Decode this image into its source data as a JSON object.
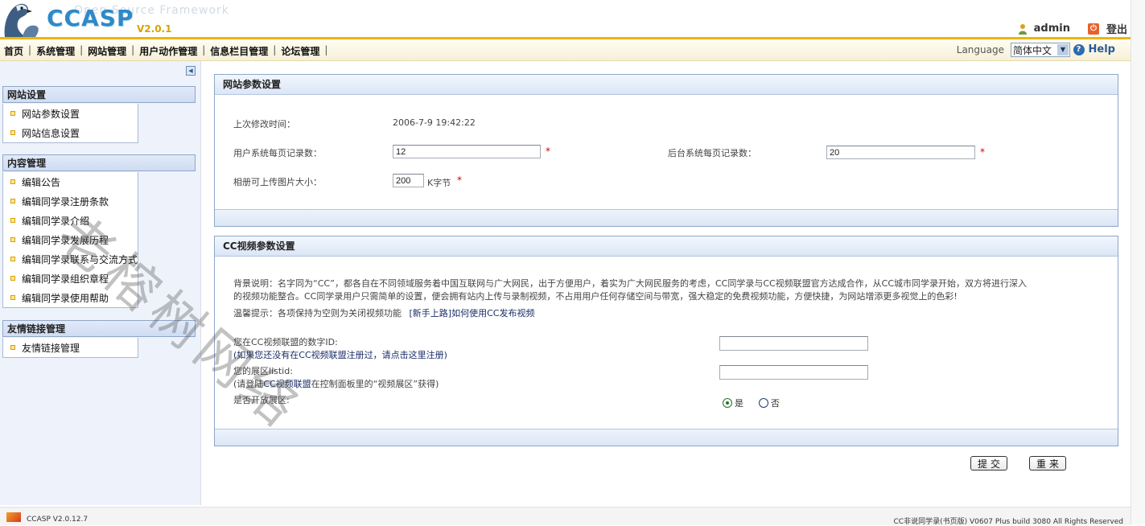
{
  "header": {
    "logo_text": "CCASP",
    "logo_version": "V2.0.1",
    "logo_subtitle": "Open Source Framework",
    "user": "admin",
    "logout": "登出"
  },
  "menu": {
    "items": [
      "首页",
      "系统管理",
      "网站管理",
      "用户动作管理",
      "信息栏目管理",
      "论坛管理"
    ],
    "language_label": "Language",
    "language_value": "简体中文",
    "help": "Help"
  },
  "sidebar": {
    "groups": [
      {
        "title": "网站设置",
        "items": [
          "网站参数设置",
          "网站信息设置"
        ]
      },
      {
        "title": "内容管理",
        "items": [
          "编辑公告",
          "编辑同学录注册条款",
          "编辑同学录介绍",
          "编辑同学录发展历程",
          "编辑同学录联系与交流方式",
          "编辑同学录组织章程",
          "编辑同学录使用帮助"
        ]
      },
      {
        "title": "友情链接管理",
        "items": [
          "友情链接管理"
        ]
      }
    ]
  },
  "panel1": {
    "title": "网站参数设置",
    "last_modified_label": "上次修改时间：",
    "last_modified_value": "2006-7-9 19:42:22",
    "user_records_label": "用户系统每页记录数：",
    "user_records_value": "12",
    "admin_records_label": "后台系统每页记录数：",
    "admin_records_value": "20",
    "album_size_label": "相册可上传图片大小：",
    "album_size_value": "200",
    "album_size_unit": "K字节",
    "required_mark": "*"
  },
  "panel2": {
    "title": "CC视频参数设置",
    "desc_line1": "背景说明：名字同为“CC”，都各自在不同领域服务着中国互联网与广大网民，出于方便用户，着实为广大网民服务的考虑，CC同学录与CC视频联盟官方达成合作，从CC城市同学录开始，双方将进行深入",
    "desc_line2": "的视频功能整合。CC同学录用户只需简单的设置，便会拥有站内上传与录制视频，不占用用户任何存储空间与带宽，强大稳定的免费视频功能，方便快捷，为网站增添更多视觉上的色彩!",
    "tip_prefix": "温馨提示：各项保持为空则为关闭视频功能",
    "tip_link": "[新手上路]如何使用CC发布视频",
    "id_label": "您在CC视频联盟的数字ID:",
    "id_hint": "(如果您还没有在CC视频联盟注册过，请点击这里注册)",
    "id_value": "",
    "listid_label": "您的展区listid:",
    "listid_hint_pre": "(请登陆",
    "listid_hint_link": "CC视频联盟",
    "listid_hint_post": "在控制面板里的“视频展区”获得)",
    "listid_value": "",
    "open_label": "是否开放展区:",
    "opt_yes": "是",
    "opt_no": "否",
    "selected": "是"
  },
  "buttons": {
    "submit": "提交",
    "reset": "重来"
  },
  "footer": {
    "left": "CCASP V2.0.12.7",
    "right": "CC非说同学录(书页版) V0607 Plus build 3080 All Rights Reserved"
  },
  "watermark": "老榕树网络",
  "colors": {
    "accent_gold": "#f1b400",
    "panel_border": "#8fa6c8",
    "required": "#d40000"
  }
}
